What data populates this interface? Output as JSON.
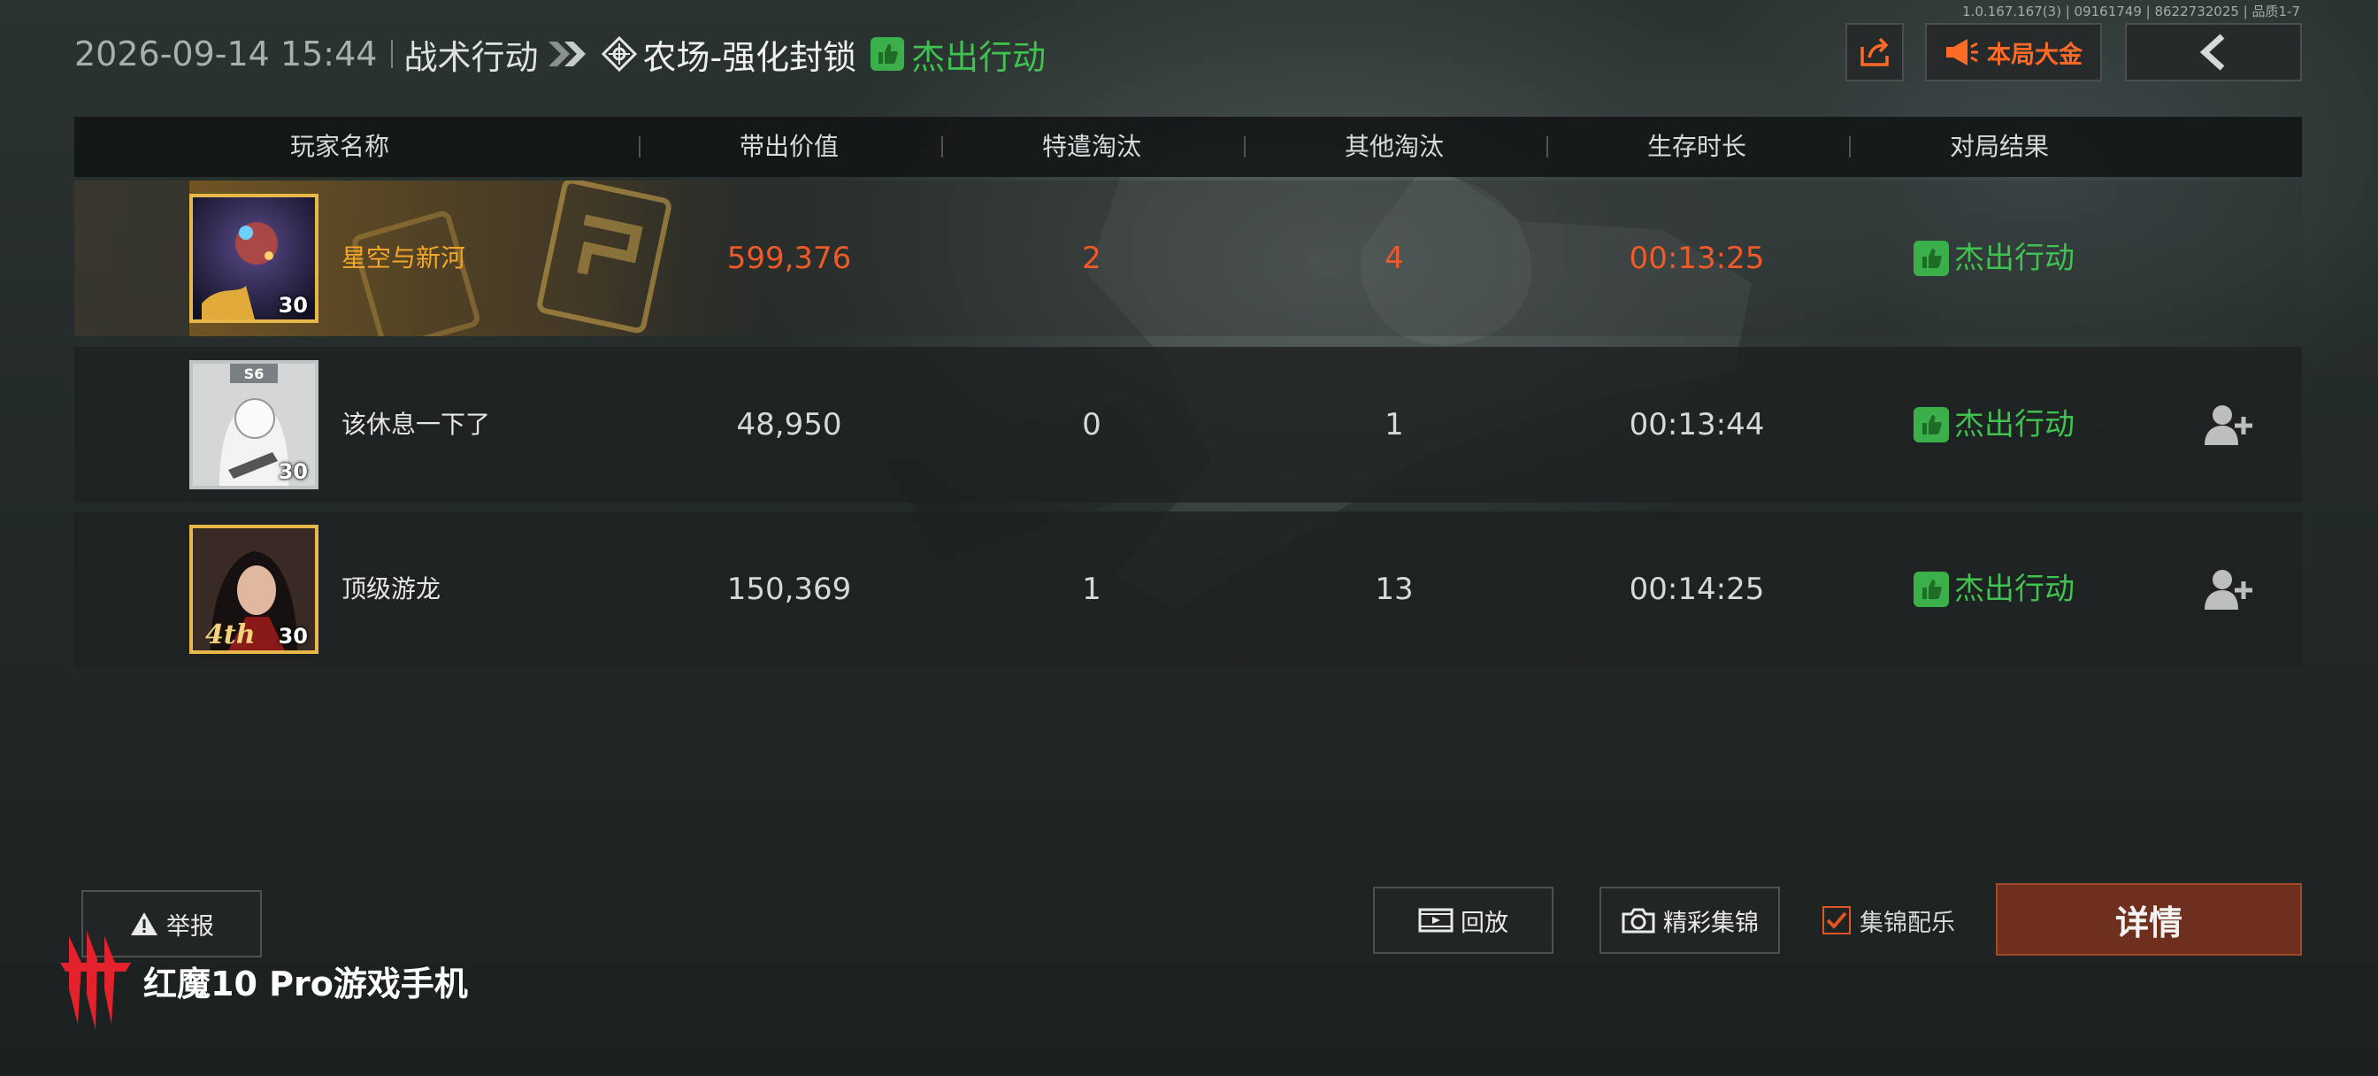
{
  "version_text": "1.0.167.167(3) | 09161749 | 8622732025 | 品质1-7",
  "header": {
    "datetime": "2026-09-14 15:44",
    "mode": "战术行动",
    "map": "农场-强化封锁",
    "result": "杰出行动"
  },
  "top_buttons": {
    "share_icon": "share-icon",
    "pot": "本局大金",
    "back_icon": "back-arrow-icon"
  },
  "columns": [
    "玩家名称",
    "带出价值",
    "特遣淘汰",
    "其他淘汰",
    "生存时长",
    "对局结果"
  ],
  "players": [
    {
      "name": "星空与新河",
      "value": "599,376",
      "special_kills": "2",
      "other_kills": "4",
      "survival": "00:13:25",
      "result": "杰出行动",
      "level": "30"
    },
    {
      "name": "该休息一下了",
      "value": "48,950",
      "special_kills": "0",
      "other_kills": "1",
      "survival": "00:13:44",
      "result": "杰出行动",
      "level": "30",
      "badge": "S6"
    },
    {
      "name": "顶级游龙",
      "value": "150,369",
      "special_kills": "1",
      "other_kills": "13",
      "survival": "00:14:25",
      "result": "杰出行动",
      "level": "30",
      "badge": "4th"
    }
  ],
  "bottom": {
    "report": "举报",
    "replay": "回放",
    "highlight": "精彩集锦",
    "music": "集锦配乐",
    "music_checked": true,
    "detail": "详情"
  },
  "brand": "红魔10 Pro游戏手机",
  "colors": {
    "accent_orange": "#ee5a28",
    "success_green": "#3fc24f",
    "gold": "#f7a627",
    "detail_bg": "#6e2f1e"
  }
}
